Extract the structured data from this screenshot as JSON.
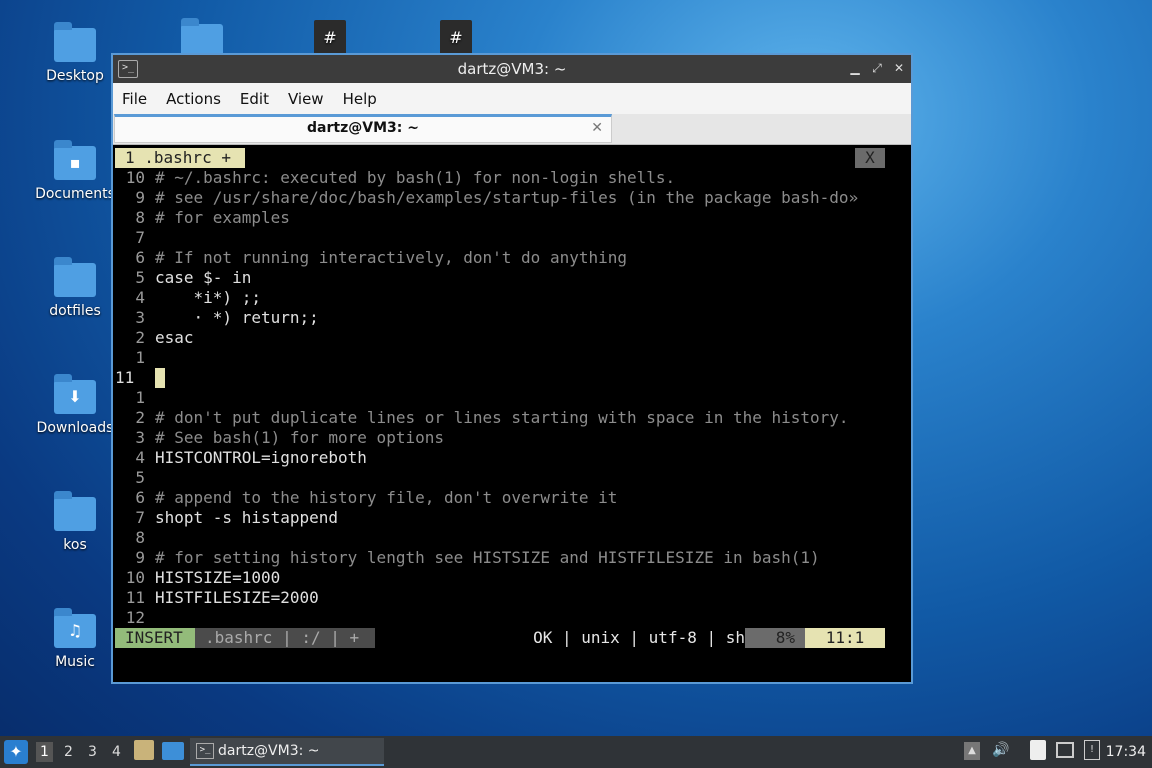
{
  "desktop": {
    "icons": [
      {
        "label": "Desktop"
      },
      {
        "label": "Documents"
      },
      {
        "label": "dotfiles"
      },
      {
        "label": "Downloads"
      },
      {
        "label": "kos"
      },
      {
        "label": "Music"
      }
    ]
  },
  "window": {
    "title": "dartz@VM3: ~",
    "menu": [
      "File",
      "Actions",
      "Edit",
      "View",
      "Help"
    ],
    "tab_title": "dartz@VM3: ~",
    "tab_close": "✕"
  },
  "vim": {
    "buffer_tab": "1 .bashrc +",
    "buffer_close": "X",
    "lines": [
      {
        "num": "10",
        "text": "# ~/.bashrc: executed by bash(1) for non-login shells.",
        "cls": "cmt"
      },
      {
        "num": "9",
        "text": "# see /usr/share/doc/bash/examples/startup-files (in the package bash-do»",
        "cls": "cmt"
      },
      {
        "num": "8",
        "text": "# for examples",
        "cls": "cmt"
      },
      {
        "num": "7",
        "text": "",
        "cls": ""
      },
      {
        "num": "6",
        "text": "# If not running interactively, don't do anything",
        "cls": "cmt"
      },
      {
        "num": "5",
        "text": "case $- in",
        "cls": "kw"
      },
      {
        "num": "4",
        "text": "    *i*) ;;",
        "cls": "kw"
      },
      {
        "num": "3",
        "text": "    · *) return;;",
        "cls": "kw"
      },
      {
        "num": "2",
        "text": "esac",
        "cls": "kw"
      },
      {
        "num": "1",
        "text": "",
        "cls": ""
      },
      {
        "num": "11",
        "text": "",
        "cls": "cur"
      },
      {
        "num": "1",
        "text": "",
        "cls": ""
      },
      {
        "num": "2",
        "text": "# don't put duplicate lines or lines starting with space in the history.",
        "cls": "cmt"
      },
      {
        "num": "3",
        "text": "# See bash(1) for more options",
        "cls": "cmt"
      },
      {
        "num": "4",
        "text": "HISTCONTROL=ignoreboth",
        "cls": "kw"
      },
      {
        "num": "5",
        "text": "",
        "cls": ""
      },
      {
        "num": "6",
        "text": "# append to the history file, don't overwrite it",
        "cls": "cmt"
      },
      {
        "num": "7",
        "text": "shopt -s histappend",
        "cls": "kw"
      },
      {
        "num": "8",
        "text": "",
        "cls": ""
      },
      {
        "num": "9",
        "text": "# for setting history length see HISTSIZE and HISTFILESIZE in bash(1)",
        "cls": "cmt"
      },
      {
        "num": "10",
        "text": "HISTSIZE=1000",
        "cls": "kw"
      },
      {
        "num": "11",
        "text": "HISTFILESIZE=2000",
        "cls": "kw"
      },
      {
        "num": "12",
        "text": "",
        "cls": ""
      }
    ],
    "status": {
      "mode": "INSERT",
      "file": ".bashrc | :/ | +",
      "info": "OK | unix | utf-8 | sh",
      "percent": "8%",
      "position": "11:1"
    }
  },
  "taskbar": {
    "workspaces": [
      "1",
      "2",
      "3",
      "4"
    ],
    "app_label": "dartz@VM3: ~",
    "clock": "17:34"
  }
}
